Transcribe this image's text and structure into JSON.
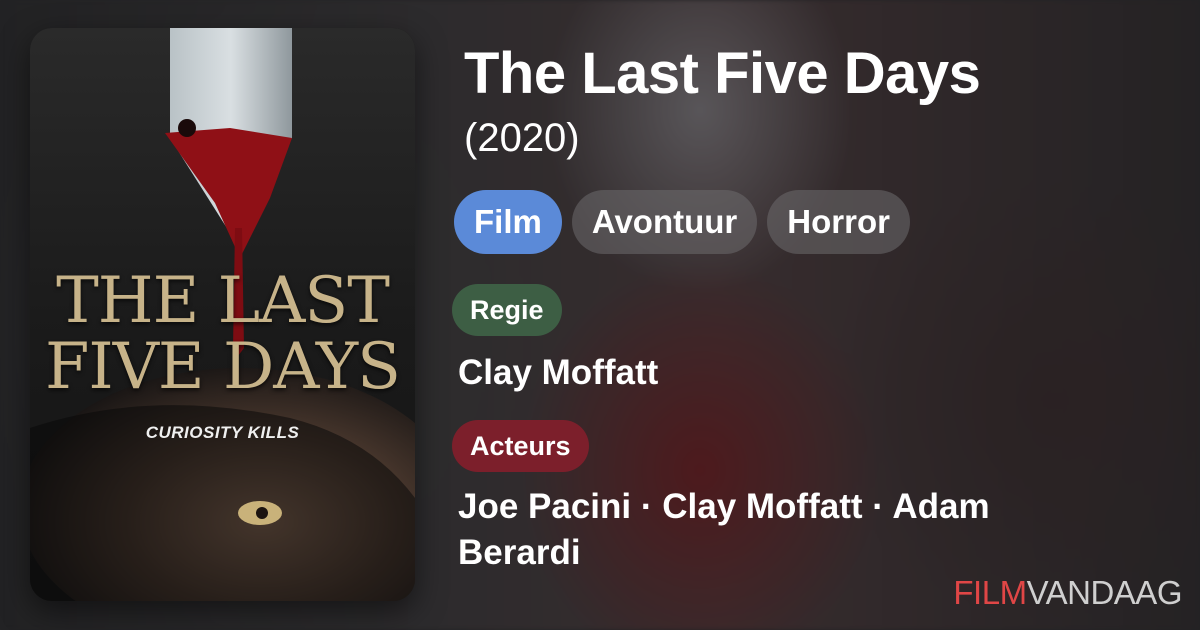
{
  "poster": {
    "title_line1": "THE LAST",
    "title_line2": "FIVE DAYS",
    "tagline": "CURIOSITY KILLS"
  },
  "movie": {
    "title": "The Last Five Days",
    "year": "(2020)"
  },
  "genres": [
    "Film",
    "Avontuur",
    "Horror"
  ],
  "credits": {
    "director_label": "Regie",
    "director": "Clay Moffatt",
    "cast_label": "Acteurs",
    "cast": "Joe Pacini · Clay Moffatt · Adam Berardi"
  },
  "brand": {
    "part1": "FILM",
    "part2": "VANDAAG"
  },
  "colors": {
    "film_chip": "#5b8ad8",
    "regie_badge": "#3d5e44",
    "acteurs_badge": "#7c1f2b",
    "brand_red": "#e04646"
  }
}
